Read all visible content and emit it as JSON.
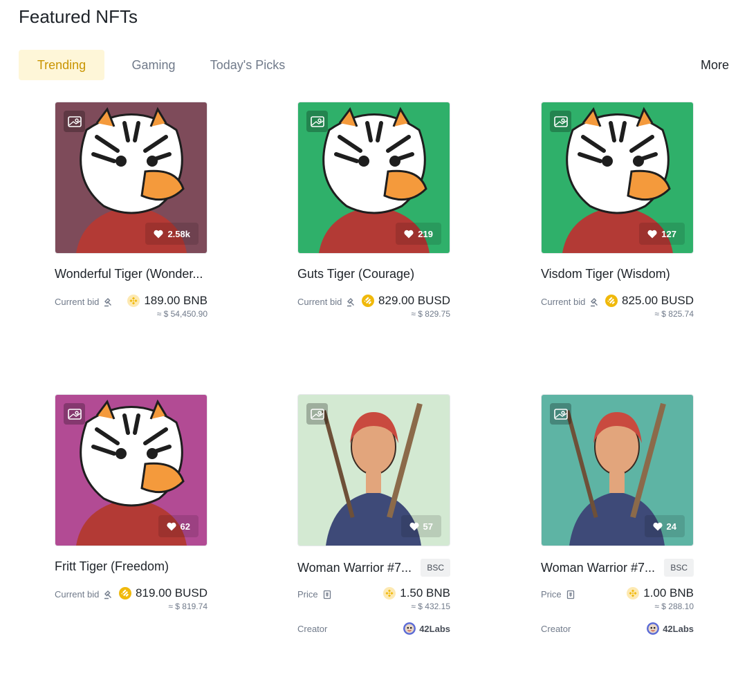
{
  "section": {
    "title": "Featured NFTs"
  },
  "tabs": [
    {
      "label": "Trending",
      "active": true
    },
    {
      "label": "Gaming",
      "active": false
    },
    {
      "label": "Today's Picks",
      "active": false
    }
  ],
  "more_label": "More",
  "colors": {
    "accent": "#c99400",
    "accent_bg": "#fef6d8",
    "text_primary": "#1e2329",
    "text_secondary": "#707a8a",
    "bnb_yellow": "#f0b90b"
  },
  "cards": [
    {
      "name": "Wonderful Tiger (Wonder...",
      "likes": "2.58k",
      "price_label": "Current bid",
      "price_label_icon": "auction-gavel-icon",
      "price": "189.00 BNB",
      "coin_icon": "bnb-coin-icon",
      "usd": "≈ $ 54,450.90",
      "art_bg": "#7e4b5a",
      "art_subject": "tiger"
    },
    {
      "name": "Guts Tiger (Courage)",
      "likes": "219",
      "price_label": "Current bid",
      "price_label_icon": "auction-gavel-icon",
      "price": "829.00 BUSD",
      "coin_icon": "busd-coin-icon",
      "usd": "≈ $ 829.75",
      "art_bg": "#2fb06a",
      "art_subject": "tiger"
    },
    {
      "name": "Visdom Tiger (Wisdom)",
      "likes": "127",
      "price_label": "Current bid",
      "price_label_icon": "auction-gavel-icon",
      "price": "825.00 BUSD",
      "coin_icon": "busd-coin-icon",
      "usd": "≈ $ 825.74",
      "art_bg": "#2fb06a",
      "art_subject": "tiger"
    },
    {
      "name": "Fritt Tiger (Freedom)",
      "likes": "62",
      "price_label": "Current bid",
      "price_label_icon": "auction-gavel-icon",
      "price": "819.00 BUSD",
      "coin_icon": "busd-coin-icon",
      "usd": "≈ $ 819.74",
      "art_bg": "#b24b94",
      "art_subject": "tiger"
    },
    {
      "name": "Woman Warrior #7...",
      "chain": "BSC",
      "likes": "57",
      "price_label": "Price",
      "price_label_icon": "fixed-price-tag-icon",
      "price": "1.50 BNB",
      "coin_icon": "bnb-coin-icon",
      "usd": "≈ $ 432.15",
      "creator_label": "Creator",
      "creator": "42Labs",
      "art_bg": "#d3e9d2",
      "art_subject": "warrior"
    },
    {
      "name": "Woman Warrior #7...",
      "chain": "BSC",
      "likes": "24",
      "price_label": "Price",
      "price_label_icon": "fixed-price-tag-icon",
      "price": "1.00 BNB",
      "coin_icon": "bnb-coin-icon",
      "usd": "≈ $ 288.10",
      "creator_label": "Creator",
      "creator": "42Labs",
      "art_bg": "#5eb4a4",
      "art_subject": "warrior"
    }
  ]
}
